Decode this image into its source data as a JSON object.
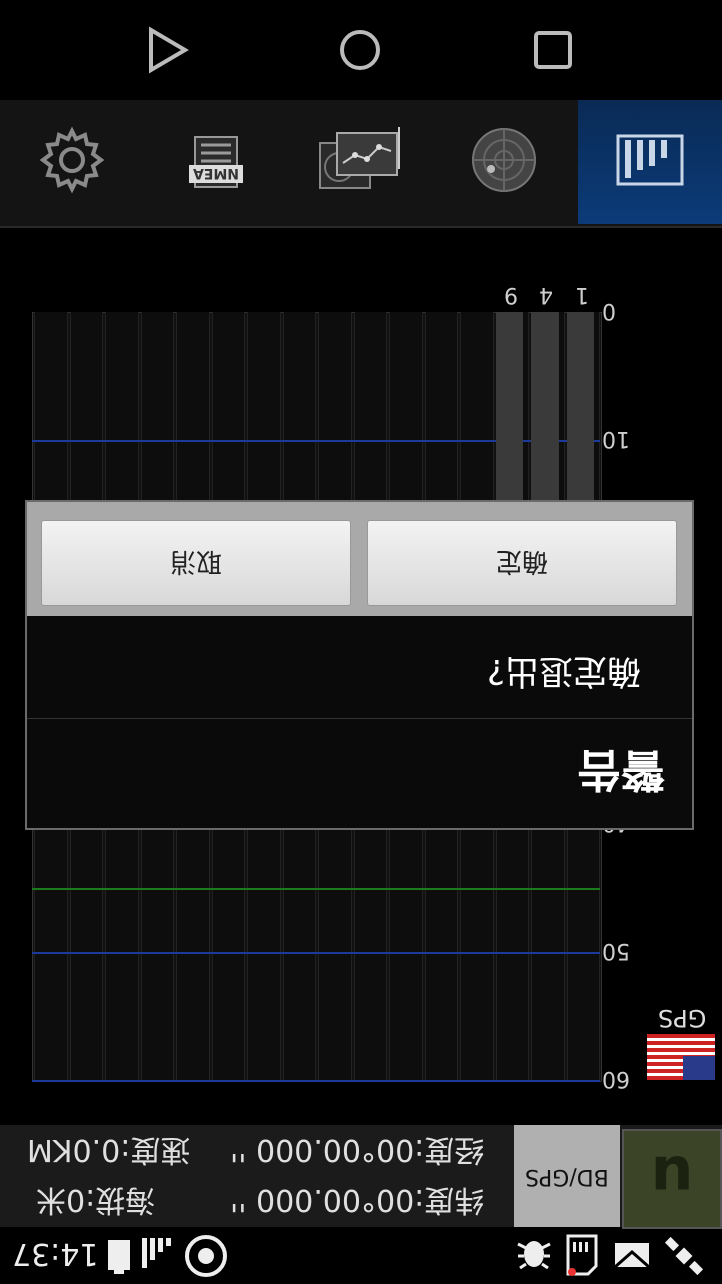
{
  "nav": {
    "icons": [
      "play-icon",
      "circle-icon",
      "square-icon"
    ]
  },
  "tabs": [
    {
      "name": "settings",
      "label": ""
    },
    {
      "name": "nmea",
      "label": "NMEA"
    },
    {
      "name": "sky-plot",
      "label": ""
    },
    {
      "name": "radar",
      "label": ""
    },
    {
      "name": "signal-bars",
      "label": ""
    }
  ],
  "chart_data": {
    "type": "bar",
    "categories": [
      "1",
      "4",
      "9"
    ],
    "values": [
      30,
      30,
      30
    ],
    "yticks": [
      "0",
      "10",
      "20",
      "30",
      "40",
      "50",
      "60"
    ],
    "ylim": [
      0,
      60
    ],
    "constellation": "GPS",
    "grid": true
  },
  "dialog": {
    "title": "警告",
    "message": "确定退出?",
    "ok_label": "确定",
    "cancel_label": "取消"
  },
  "info": {
    "mode_label": "BD/GPS",
    "latitude": "纬度:00°00.000 ''",
    "longitude": "经度:00°00.000 ''",
    "altitude": "海拔:0米",
    "speed": "速度:0.0KM"
  },
  "status": {
    "time": "14:37"
  },
  "colors": {
    "accent": "#0b3b78",
    "grid_blue": "#1b3a9a",
    "grid_green": "#1e7a1e"
  }
}
